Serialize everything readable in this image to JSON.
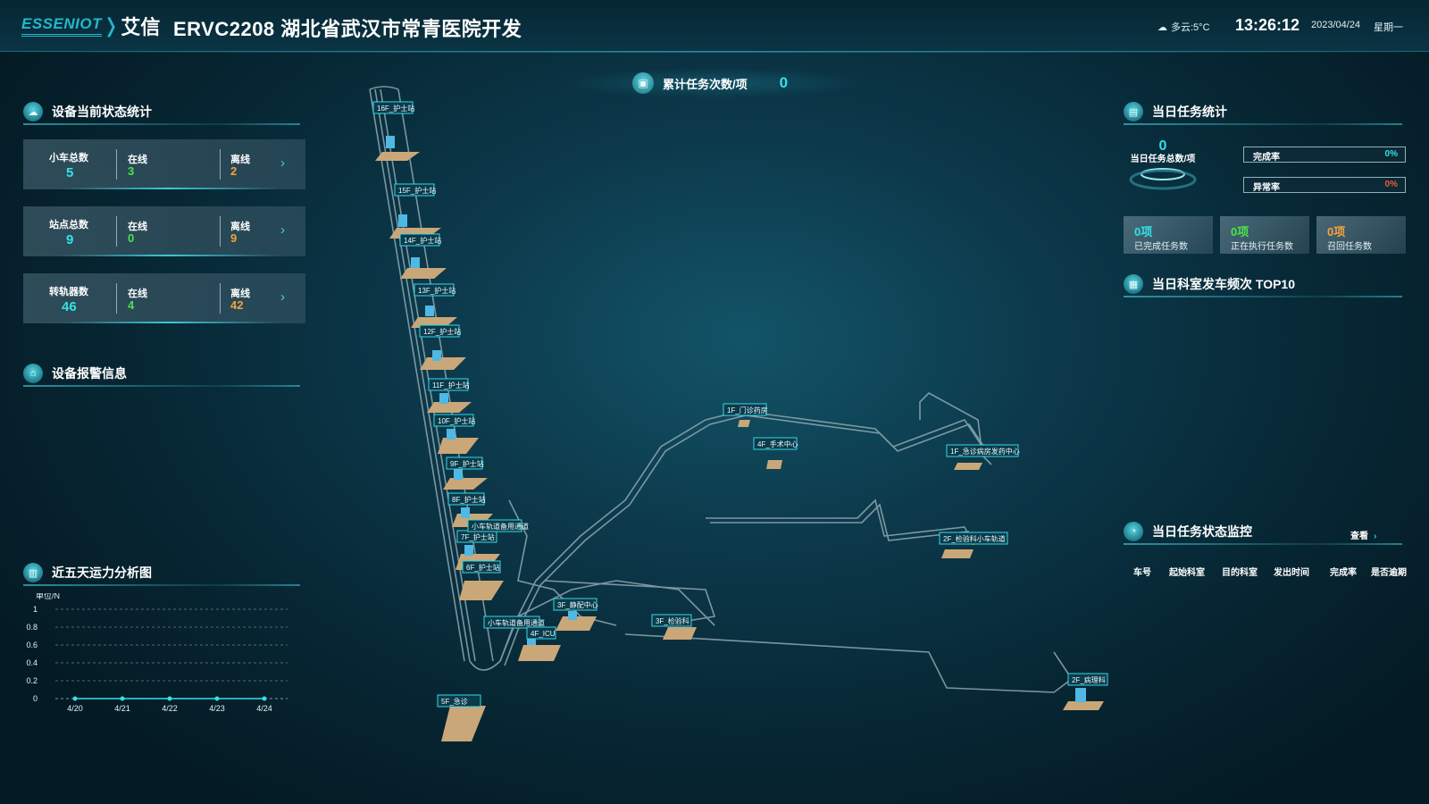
{
  "header": {
    "logo_en": "ESSENIOT",
    "logo_cn": "艾信",
    "title": "ERVC2208 湖北省武汉市常青医院开发",
    "weather": "多云:5°C",
    "time": "13:26:12",
    "date": "2023/04/24",
    "weekday": "星期一"
  },
  "left": {
    "device_status_title": "设备当前状态统计",
    "cards": [
      {
        "label": "小车总数",
        "total": "5",
        "online_label": "在线",
        "online": "3",
        "offline_label": "离线",
        "offline": "2"
      },
      {
        "label": "站点总数",
        "total": "9",
        "online_label": "在线",
        "online": "0",
        "offline_label": "离线",
        "offline": "9"
      },
      {
        "label": "转轨器数",
        "total": "46",
        "online_label": "在线",
        "online": "4",
        "offline_label": "离线",
        "offline": "42"
      }
    ],
    "alarm_title": "设备报警信息",
    "capacity_title": "近五天运力分析图"
  },
  "chart_data": {
    "type": "line",
    "unit_label": "单位/N",
    "categories": [
      "4/20",
      "4/21",
      "4/22",
      "4/23",
      "4/24"
    ],
    "values": [
      0,
      0,
      0,
      0,
      0
    ],
    "yticks": [
      "1",
      "0.8",
      "0.6",
      "0.4",
      "0.2",
      "0"
    ],
    "ylim": [
      0,
      1
    ],
    "grid": true
  },
  "center": {
    "kpi_label": "累计任务次数/项",
    "kpi_value": "0",
    "stations": [
      "16F_护士站",
      "15F_护士站",
      "14F_护士站",
      "13F_护士站",
      "12F_护士站",
      "11F_护士站",
      "10F_护士站",
      "9F_护士站",
      "8F_护士站",
      "7F_护士站",
      "6F_护士站",
      "小车轨道备用通道",
      "3F_静配中心",
      "小车轨道备用通道",
      "4F_ICU",
      "3F_检验科",
      "5F_急诊",
      "1F_门诊药房",
      "4F_手术中心",
      "1F_急诊病房发药中心",
      "2F_检验科小车轨道",
      "2F_病理科"
    ]
  },
  "right": {
    "daily_title": "当日任务统计",
    "daily_total": "0",
    "daily_total_label": "当日任务总数/项",
    "completion_label": "完成率",
    "completion_value": "0%",
    "abnormal_label": "异常率",
    "abnormal_value": "0%",
    "boxes": [
      {
        "value": "0项",
        "label": "已完成任务数"
      },
      {
        "value": "0项",
        "label": "正在执行任务数"
      },
      {
        "value": "0项",
        "label": "召回任务数"
      }
    ],
    "top10_title": "当日科室发车频次 TOP10",
    "monitor_title": "当日任务状态监控",
    "view_label": "查看",
    "table_headers": [
      "车号",
      "起始科室",
      "目的科室",
      "发出时间",
      "完成率",
      "是否逾期"
    ]
  },
  "colors": {
    "accent": "#35e0e6",
    "online": "#4be34b",
    "offline": "#f3a33c",
    "abnormal": "#f05a3a"
  }
}
